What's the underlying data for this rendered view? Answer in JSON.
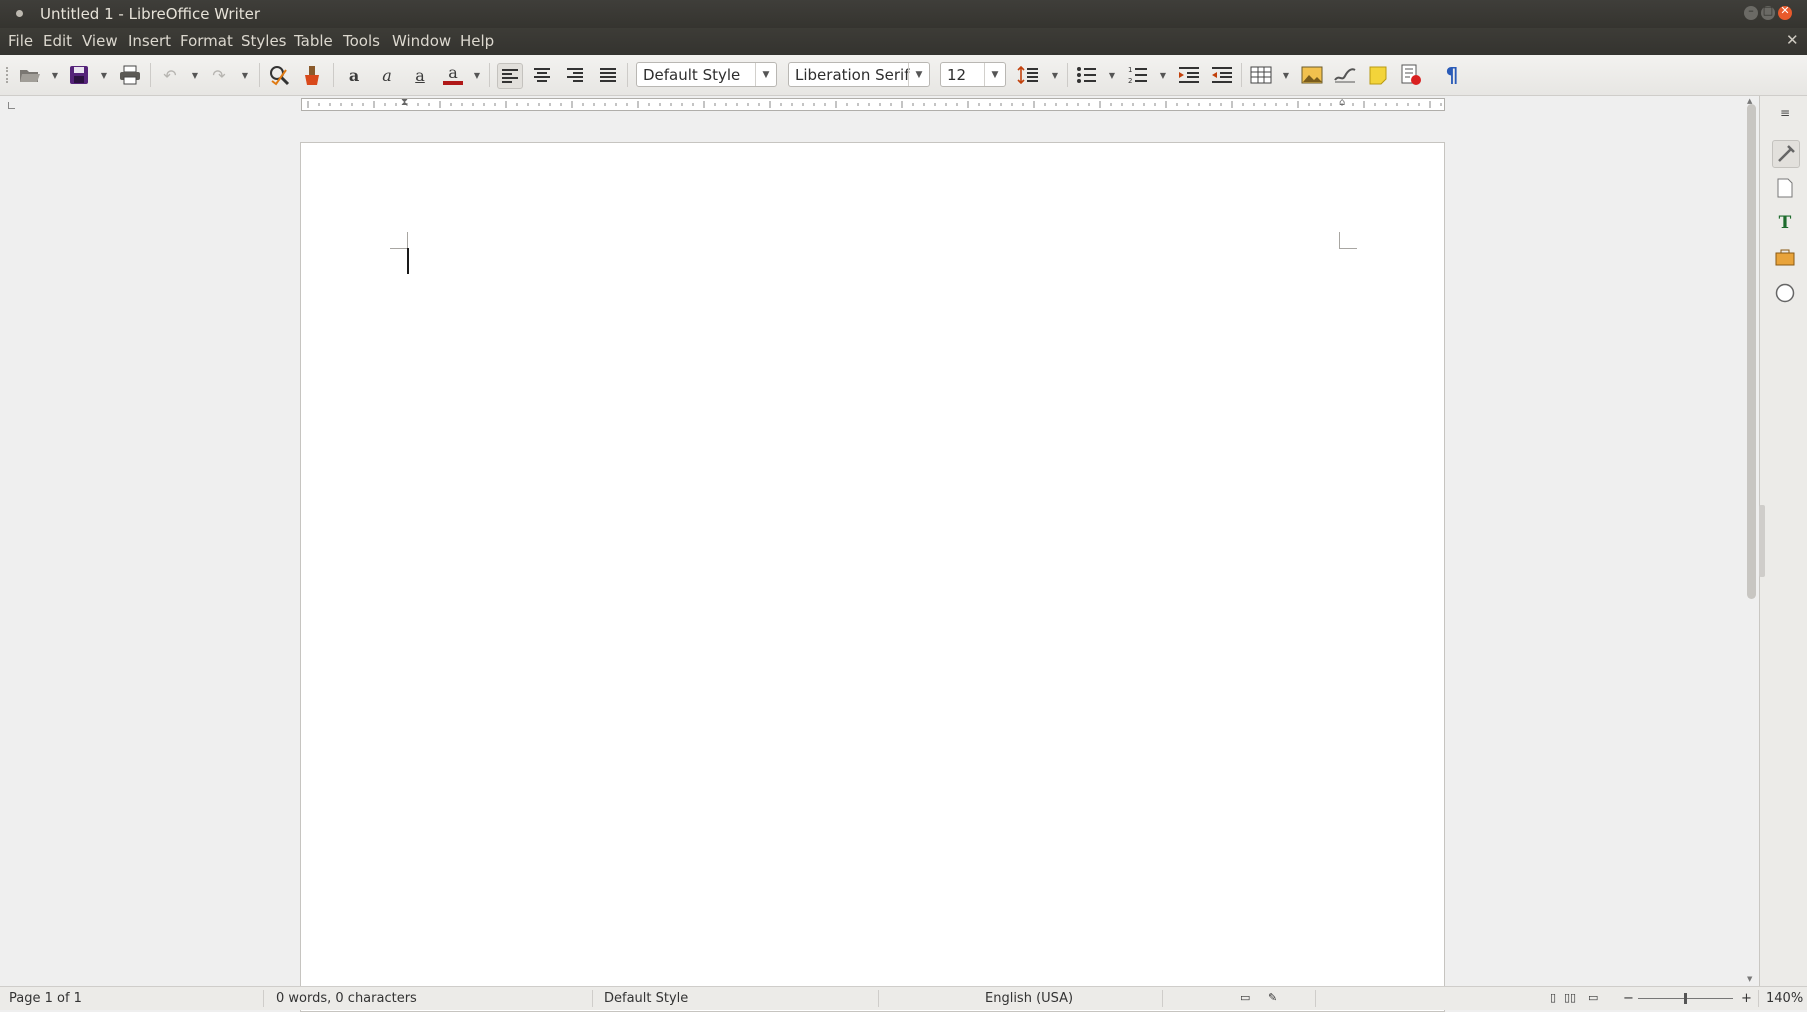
{
  "window": {
    "title": "Untitled 1 - LibreOffice Writer",
    "minimize": "–",
    "maximize": "□",
    "close": "✕"
  },
  "menu": {
    "items": [
      "File",
      "Edit",
      "View",
      "Insert",
      "Format",
      "Styles",
      "Table",
      "Tools",
      "Window",
      "Help"
    ],
    "close_document": "✕"
  },
  "toolbar": {
    "paragraph_style": "Default Style",
    "font_name": "Liberation Serif",
    "font_size": "12",
    "icons": [
      "open-icon",
      "save-icon",
      "print-icon",
      "undo-icon",
      "redo-icon",
      "clone-formatting-icon",
      "clear-formatting-icon",
      "bold-icon",
      "italic-icon",
      "underline-icon",
      "font-color-icon",
      "align-left-icon",
      "align-center-icon",
      "align-right-icon",
      "justify-icon",
      "line-spacing-icon",
      "bullet-list-icon",
      "numbered-list-icon",
      "increase-indent-icon",
      "decrease-indent-icon",
      "insert-table-icon",
      "insert-image-icon",
      "insert-chart-icon",
      "insert-comment-icon",
      "track-changes-icon",
      "formatting-marks-icon"
    ],
    "font_color": "#b01818"
  },
  "sidebar": {
    "icons": [
      "sidebar-menu-icon",
      "properties-icon",
      "page-icon",
      "styles-icon",
      "gallery-icon",
      "navigator-icon"
    ]
  },
  "status": {
    "page": "Page 1 of 1",
    "word_count": "0 words, 0 characters",
    "page_style": "Default Style",
    "language": "English (USA)",
    "zoom": "140%",
    "zoom_out": "−",
    "zoom_in": "+"
  }
}
